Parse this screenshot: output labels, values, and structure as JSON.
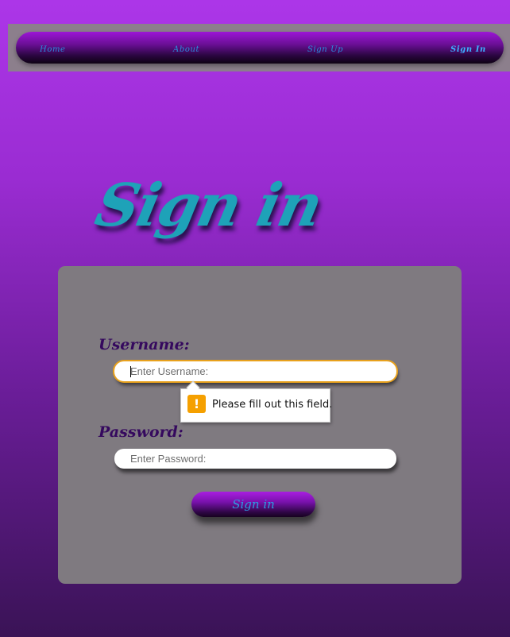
{
  "nav": {
    "items": [
      {
        "label": "Home"
      },
      {
        "label": "About"
      },
      {
        "label": "Sign Up"
      },
      {
        "label": "Sign In",
        "active": true
      }
    ]
  },
  "page": {
    "title": "Sign in"
  },
  "form": {
    "username": {
      "label": "Username:",
      "placeholder": "Enter Username:",
      "value": ""
    },
    "password": {
      "label": "Password:",
      "placeholder": "Enter Password:",
      "value": ""
    },
    "submit_label": "Sign in",
    "validation": {
      "message": "Please fill out this field.",
      "icon": "warning-icon",
      "icon_glyph": "!"
    }
  },
  "colors": {
    "background_top": "#ac36e8",
    "background_bottom": "#3a1356",
    "nav_link": "#2b8ddb",
    "title": "#1ea2b8",
    "card": "#7f7a80",
    "label": "#35095e",
    "focus_ring": "#e8a11c",
    "warning": "#f5a000"
  }
}
